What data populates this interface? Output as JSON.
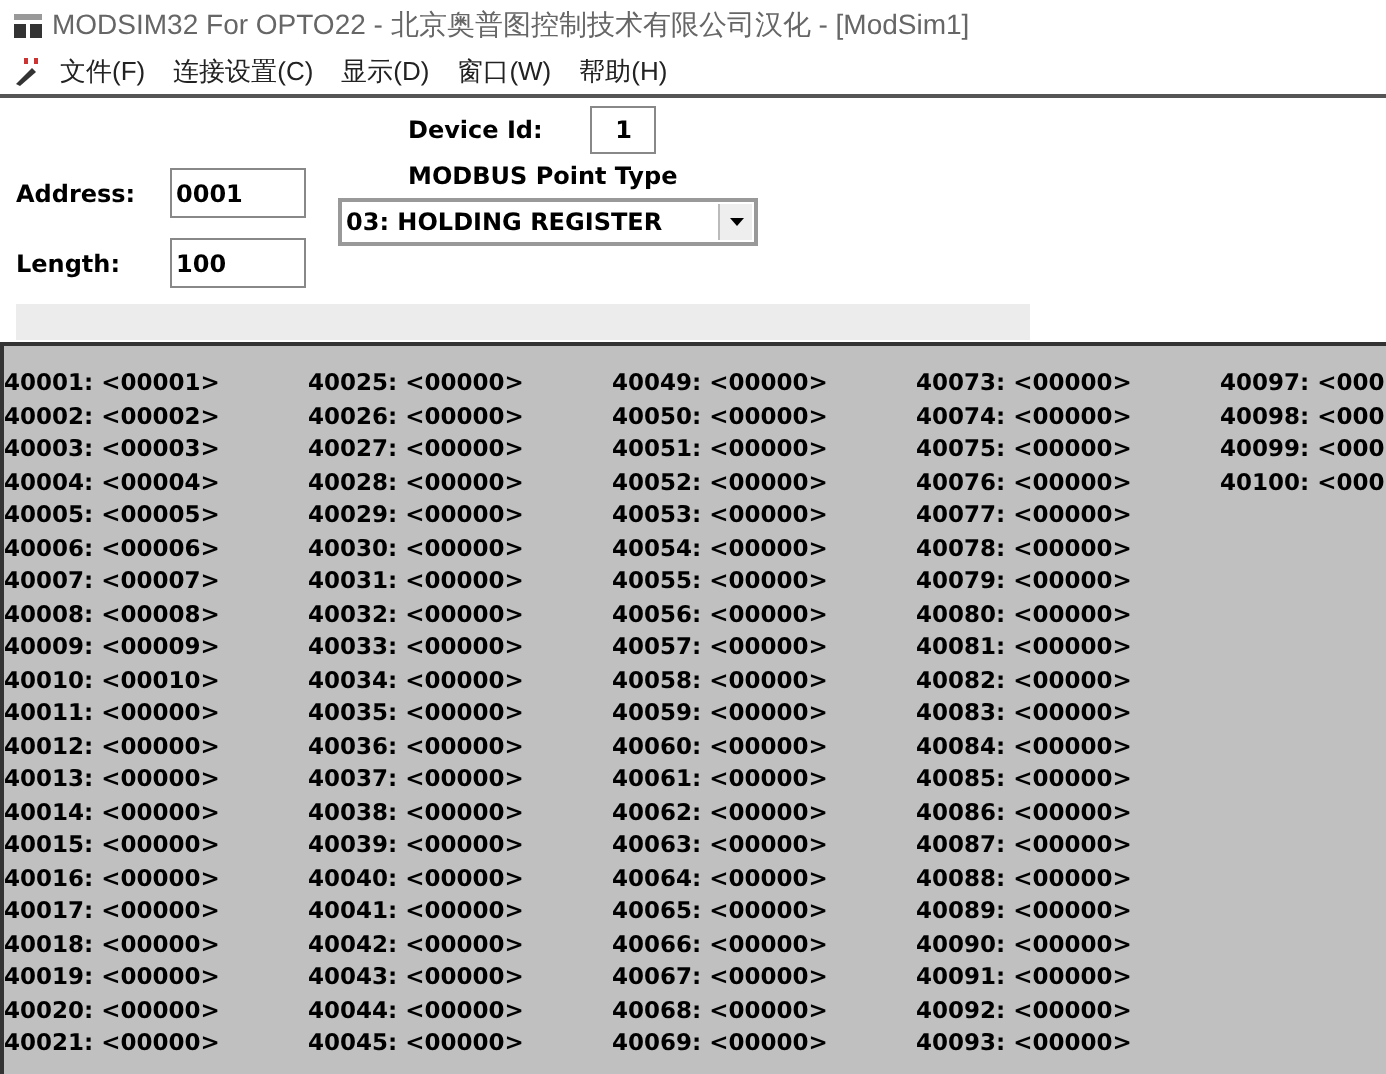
{
  "window": {
    "title": "MODSIM32 For OPTO22 - 北京奥普图控制技术有限公司汉化 - [ModSim1]"
  },
  "menu": [
    "文件(F)",
    "连接设置(C)",
    "显示(D)",
    "窗口(W)",
    "帮助(H)"
  ],
  "form": {
    "address_label": "Address:",
    "address": "0001",
    "length_label": "Length:",
    "length": "100",
    "device_id_label": "Device Id:",
    "device_id": "1",
    "point_type_label": "MODBUS Point Type",
    "point_type": "03: HOLDING REGISTER"
  },
  "registers": {
    "columns": [
      [
        "40001: <00001>",
        "40002: <00002>",
        "40003: <00003>",
        "40004: <00004>",
        "40005: <00005>",
        "40006: <00006>",
        "40007: <00007>",
        "40008: <00008>",
        "40009: <00009>",
        "40010: <00010>",
        "40011: <00000>",
        "40012: <00000>",
        "40013: <00000>",
        "40014: <00000>",
        "40015: <00000>",
        "40016: <00000>",
        "40017: <00000>",
        "40018: <00000>",
        "40019: <00000>",
        "40020: <00000>",
        "40021: <00000>"
      ],
      [
        "40025: <00000>",
        "40026: <00000>",
        "40027: <00000>",
        "40028: <00000>",
        "40029: <00000>",
        "40030: <00000>",
        "40031: <00000>",
        "40032: <00000>",
        "40033: <00000>",
        "40034: <00000>",
        "40035: <00000>",
        "40036: <00000>",
        "40037: <00000>",
        "40038: <00000>",
        "40039: <00000>",
        "40040: <00000>",
        "40041: <00000>",
        "40042: <00000>",
        "40043: <00000>",
        "40044: <00000>",
        "40045: <00000>"
      ],
      [
        "40049: <00000>",
        "40050: <00000>",
        "40051: <00000>",
        "40052: <00000>",
        "40053: <00000>",
        "40054: <00000>",
        "40055: <00000>",
        "40056: <00000>",
        "40057: <00000>",
        "40058: <00000>",
        "40059: <00000>",
        "40060: <00000>",
        "40061: <00000>",
        "40062: <00000>",
        "40063: <00000>",
        "40064: <00000>",
        "40065: <00000>",
        "40066: <00000>",
        "40067: <00000>",
        "40068: <00000>",
        "40069: <00000>"
      ],
      [
        "40073: <00000>",
        "40074: <00000>",
        "40075: <00000>",
        "40076: <00000>",
        "40077: <00000>",
        "40078: <00000>",
        "40079: <00000>",
        "40080: <00000>",
        "40081: <00000>",
        "40082: <00000>",
        "40083: <00000>",
        "40084: <00000>",
        "40085: <00000>",
        "40086: <00000>",
        "40087: <00000>",
        "40088: <00000>",
        "40089: <00000>",
        "40090: <00000>",
        "40091: <00000>",
        "40092: <00000>",
        "40093: <00000>"
      ],
      [
        "40097: <000",
        "40098: <000",
        "40099: <000",
        "40100: <000"
      ]
    ]
  }
}
